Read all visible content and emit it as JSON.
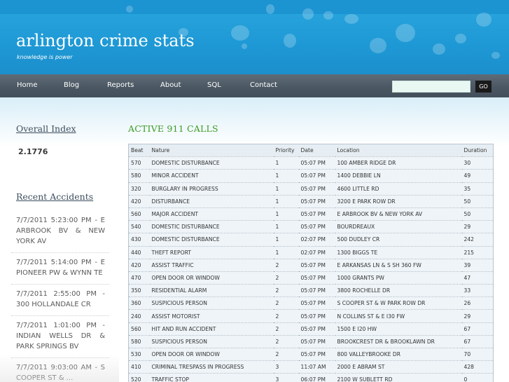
{
  "site": {
    "title": "arlington crime stats",
    "tagline": "knowledge is power"
  },
  "nav": {
    "items": [
      "Home",
      "Blog",
      "Reports",
      "About",
      "SQL",
      "Contact"
    ],
    "search_value": "",
    "search_button": "GO"
  },
  "sidebar": {
    "index_heading": "Overall Index",
    "index_value": "2.1776",
    "accidents_heading": "Recent Accidents",
    "accidents": [
      "7/7/2011 5:23:00 PM - E ARBROOK BV & NEW YORK AV",
      "7/7/2011 5:14:00 PM - E PIONEER PW & WYNN TE",
      "7/7/2011 2:55:00 PM - 300 HOLLANDALE CR",
      "7/7/2011 1:01:00 PM - INDIAN WELLS DR & PARK SPRINGS BV",
      "7/7/2011 9:03:00 AM - S COOPER ST & ..."
    ]
  },
  "main": {
    "title": "ACTIVE 911 CALLS",
    "columns": [
      "Beat",
      "Nature",
      "Priority",
      "Date",
      "Location",
      "Duration"
    ],
    "rows": [
      [
        "570",
        "DOMESTIC DISTURBANCE",
        "1",
        "05:07 PM",
        "100 AMBER RIDGE DR",
        "30"
      ],
      [
        "580",
        "MINOR ACCIDENT",
        "1",
        "05:07 PM",
        "1400 DEBBIE LN",
        "49"
      ],
      [
        "320",
        "BURGLARY IN PROGRESS",
        "1",
        "05:07 PM",
        "4600 LITTLE RD",
        "35"
      ],
      [
        "420",
        "DISTURBANCE",
        "1",
        "05:07 PM",
        "3200 E PARK ROW DR",
        "50"
      ],
      [
        "560",
        "MAJOR ACCIDENT",
        "1",
        "05:07 PM",
        "E ARBROOK BV & NEW YORK AV",
        "50"
      ],
      [
        "540",
        "DOMESTIC DISTURBANCE",
        "1",
        "05:07 PM",
        "BOURDREAUX",
        "29"
      ],
      [
        "430",
        "DOMESTIC DISTURBANCE",
        "1",
        "02:07 PM",
        "500 DUDLEY CR",
        "242"
      ],
      [
        "440",
        "THEFT REPORT",
        "1",
        "02:07 PM",
        "1300 BIGGS TE",
        "215"
      ],
      [
        "420",
        "ASSIST TRAFFIC",
        "2",
        "05:07 PM",
        "E ARKANSAS LN & S SH 360 FW",
        "39"
      ],
      [
        "470",
        "OPEN DOOR OR WINDOW",
        "2",
        "05:07 PM",
        "1000 GRANTS PW",
        "47"
      ],
      [
        "350",
        "RESIDENTIAL ALARM",
        "2",
        "05:07 PM",
        "3800 ROCHELLE DR",
        "33"
      ],
      [
        "360",
        "SUSPICIOUS PERSON",
        "2",
        "05:07 PM",
        "S COOPER ST & W PARK ROW DR",
        "26"
      ],
      [
        "240",
        "ASSIST MOTORIST",
        "2",
        "05:07 PM",
        "N COLLINS ST & E I30 FW",
        "29"
      ],
      [
        "560",
        "HIT AND RUN ACCIDENT",
        "2",
        "05:07 PM",
        "1500 E I20 HW",
        "67"
      ],
      [
        "580",
        "SUSPICIOUS PERSON",
        "2",
        "05:07 PM",
        "BROOKCREST DR & BROOKLAWN DR",
        "67"
      ],
      [
        "530",
        "OPEN DOOR OR WINDOW",
        "2",
        "05:07 PM",
        "800 VALLEYBROOKE DR",
        "70"
      ],
      [
        "410",
        "CRIMINAL TRESPASS IN PROGRESS",
        "3",
        "11:07 AM",
        "2000 E ABRAM ST",
        "428"
      ],
      [
        "520",
        "TRAFFIC STOP",
        "3",
        "06:07 PM",
        "2100 W SUBLETT RD",
        "0"
      ]
    ]
  },
  "colors": {
    "header_blue": "#1f9ad6",
    "nav_gray": "#4a5661",
    "title_green": "#3d9b25"
  }
}
